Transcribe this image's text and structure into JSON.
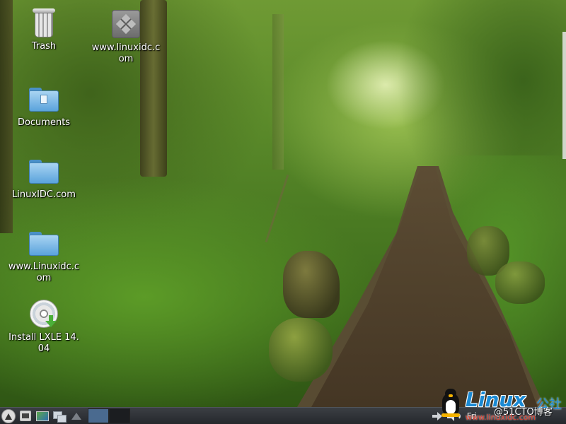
{
  "desktop": {
    "icons": [
      {
        "label": "Trash",
        "icon": "trash-icon"
      },
      {
        "label": "www.linuxidc.com",
        "icon": "application-icon"
      },
      {
        "label": "Documents",
        "icon": "folder-documents-icon"
      },
      {
        "label": "LinuxIDC.com",
        "icon": "folder-icon"
      },
      {
        "label": "www.Linuxidc.com",
        "icon": "folder-icon"
      },
      {
        "label": "Install LXLE 14.04",
        "icon": "cd-install-icon"
      }
    ]
  },
  "panel": {
    "launchers": [
      "start-menu-icon",
      "terminal-icon",
      "monitor-icon",
      "windows-icon",
      "arrow-up-icon"
    ],
    "workspaces": [
      {
        "active": true
      },
      {
        "active": false
      }
    ],
    "tray": [
      "arrow-right-icon",
      "volume-icon"
    ],
    "clock": "Fri"
  },
  "watermark": {
    "brand": "Linux",
    "brand_cjk": "公社",
    "blog": "@51CTO博客",
    "site": "www.linuxidc.com"
  },
  "colors": {
    "panel": "#2e3136",
    "workspace_active": "#4a6a8f",
    "label_text": "#ffffff",
    "watermark_blue": "#1a8ad4",
    "watermark_red": "#e03a2a"
  }
}
